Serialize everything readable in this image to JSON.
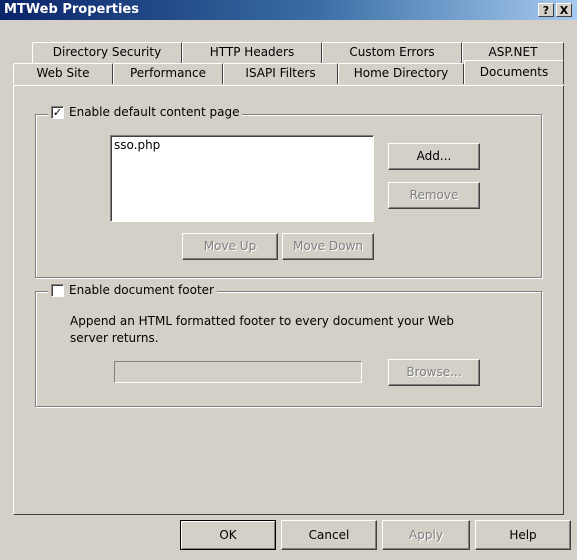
{
  "window": {
    "title": "MTWeb Properties",
    "help_button": "?",
    "close_button": "X"
  },
  "tabs": {
    "row1": [
      "Directory Security",
      "HTTP Headers",
      "Custom Errors",
      "ASP.NET"
    ],
    "row2": [
      "Web Site",
      "Performance",
      "ISAPI Filters",
      "Home Directory",
      "Documents"
    ],
    "active": "Documents"
  },
  "default_content": {
    "label": "Enable default content page",
    "checked": true,
    "items": [
      "sso.php"
    ],
    "add_label": "Add...",
    "remove_label": "Remove",
    "move_up_label": "Move Up",
    "move_down_label": "Move Down"
  },
  "footer": {
    "label": "Enable document footer",
    "checked": false,
    "description_line1": "Append an HTML formatted footer to every document your Web",
    "description_line2": "server returns.",
    "path_value": "",
    "browse_label": "Browse..."
  },
  "dialog_buttons": {
    "ok": "OK",
    "cancel": "Cancel",
    "apply": "Apply",
    "help": "Help"
  }
}
